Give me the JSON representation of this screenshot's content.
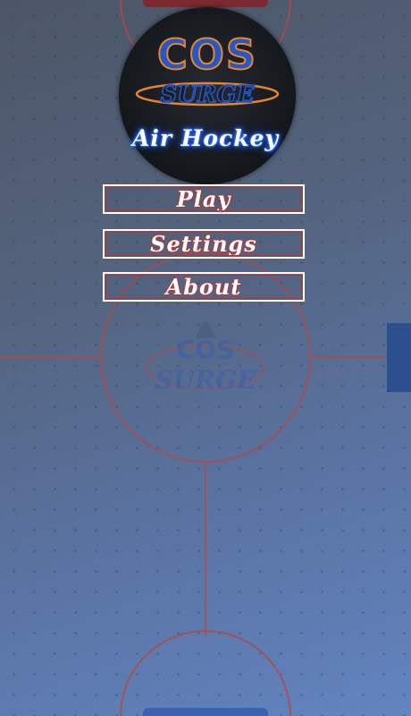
{
  "game": {
    "logo": {
      "brand_text": "COS",
      "wordmark_text": "SURGE"
    },
    "title": "Air Hockey",
    "menu": [
      {
        "label": "Play"
      },
      {
        "label": "Settings"
      },
      {
        "label": "About"
      }
    ],
    "colors": {
      "rink_top": "#4c5666",
      "rink_bottom": "#6384c0",
      "line_red": "#b04a44",
      "goal_blue": "#2c4f8e",
      "goal_red": "#7b2a32",
      "logo_blue": "#2458c8",
      "logo_orange": "#e8842a",
      "title_glow": "#2b6bff",
      "button_border": "#ffffff",
      "button_accent": "#c2302e"
    }
  }
}
